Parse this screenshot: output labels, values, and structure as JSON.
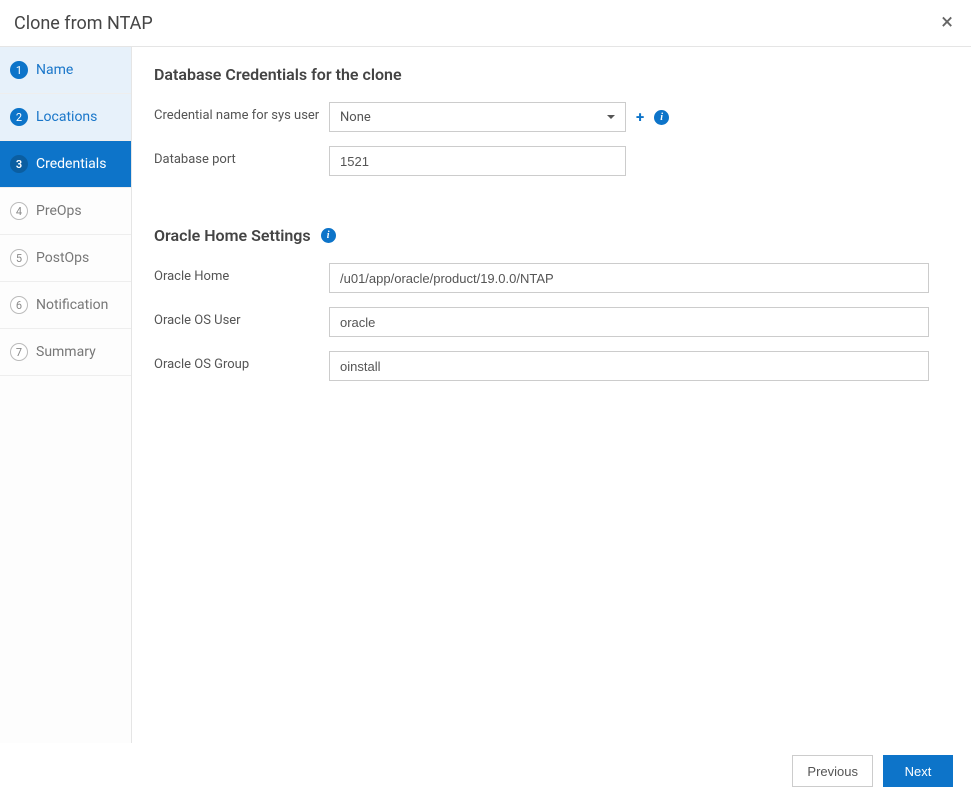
{
  "header": {
    "title": "Clone from NTAP"
  },
  "sidebar": {
    "steps": [
      {
        "num": "1",
        "label": "Name",
        "state": "completed"
      },
      {
        "num": "2",
        "label": "Locations",
        "state": "completed"
      },
      {
        "num": "3",
        "label": "Credentials",
        "state": "active"
      },
      {
        "num": "4",
        "label": "PreOps",
        "state": "pending"
      },
      {
        "num": "5",
        "label": "PostOps",
        "state": "pending"
      },
      {
        "num": "6",
        "label": "Notification",
        "state": "pending"
      },
      {
        "num": "7",
        "label": "Summary",
        "state": "pending"
      }
    ]
  },
  "content": {
    "section1_title": "Database Credentials for the clone",
    "credential_label": "Credential name for sys user",
    "credential_value": "None",
    "port_label": "Database port",
    "port_value": "1521",
    "section2_title": "Oracle Home Settings",
    "oracle_home_label": "Oracle Home",
    "oracle_home_value": "/u01/app/oracle/product/19.0.0/NTAP",
    "os_user_label": "Oracle OS User",
    "os_user_value": "oracle",
    "os_group_label": "Oracle OS Group",
    "os_group_value": "oinstall"
  },
  "footer": {
    "previous": "Previous",
    "next": "Next"
  }
}
